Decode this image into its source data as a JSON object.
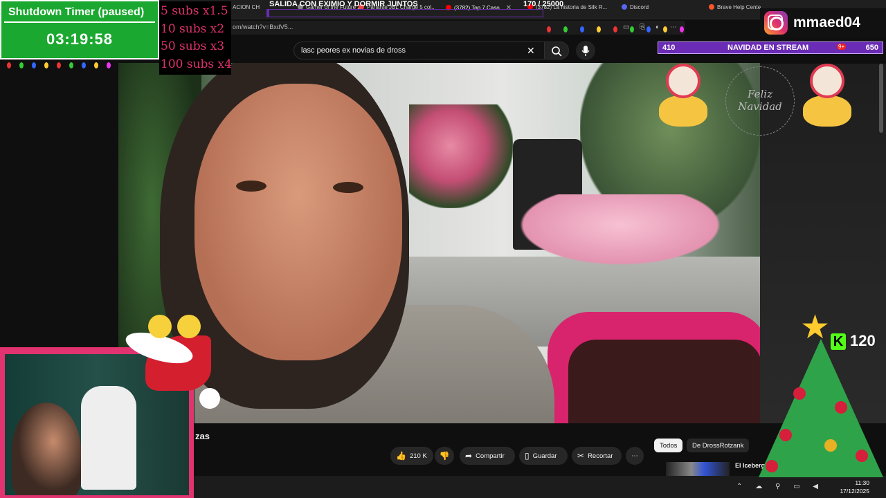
{
  "timer": {
    "title": "Shutdown Timer (paused)",
    "value": "03:19:58"
  },
  "subs_multipliers": [
    "5 subs x1.5",
    "10 subs x2",
    "50 subs x3",
    "100 subs x4"
  ],
  "goal": {
    "text": "SALIDA CON EXIMIO Y DORMIR JUNTOS",
    "current": 170,
    "target": 25000,
    "count_label": "170  / 25000"
  },
  "browser": {
    "tabs": [
      {
        "label": "ACION CH",
        "active": false
      },
      {
        "label": "Gamer of the Future 202...",
        "active": false
      },
      {
        "label": "Parlante JBL Charge 5 col...",
        "active": false
      },
      {
        "label": "(3782) Top 7 Caso...",
        "active": true
      },
      {
        "label": "(3782) La historia de Silk R...",
        "active": false
      },
      {
        "label": "Discord",
        "active": false
      },
      {
        "label": "Brave Help Cente...",
        "active": false
      }
    ],
    "url": "om/watch?v=BxdV5...",
    "search_value": "lasc peores ex novias de dross"
  },
  "instagram": {
    "handle": "mmaed04"
  },
  "stream_banner": {
    "left_count": "410",
    "title": "NAVIDAD EN STREAM",
    "right_count": "650",
    "badge": "9+"
  },
  "decor": {
    "feliz_line1": "Feliz",
    "feliz_line2": "Navidad"
  },
  "video": {
    "title_fragment": "zas",
    "actions": {
      "like_count": "210 K",
      "share": "Compartir",
      "save": "Guardar",
      "clip": "Recortar",
      "more": "⋯"
    }
  },
  "recommendations": {
    "chips": [
      "Todos",
      "De DrossRotzank"
    ],
    "first_title": "El Iceberg De L..."
  },
  "kick": {
    "count": "120"
  },
  "taskbar": {
    "time": "11:30",
    "date": "17/12/2025"
  },
  "colors": {
    "timer_green": "#1ba830",
    "accent_purple": "#6a2bb5",
    "webcam_frame": "#e0336f",
    "kick_green": "#53fc18"
  },
  "icons": [
    "search-icon",
    "mic-icon",
    "close-icon",
    "like-icon",
    "dislike-icon",
    "share-icon",
    "save-icon",
    "clip-icon",
    "instagram-icon",
    "kick-icon"
  ]
}
